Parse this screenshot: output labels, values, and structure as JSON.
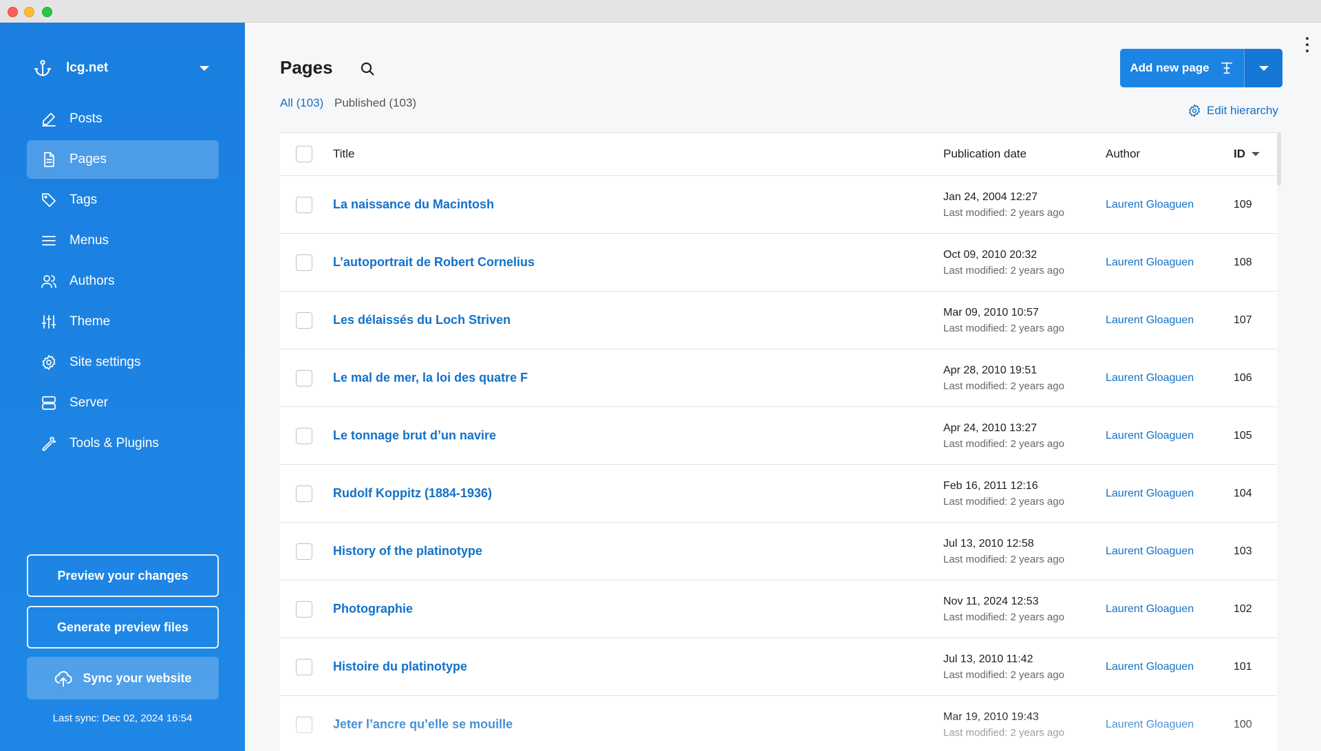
{
  "sidebar": {
    "site_name": "lcg.net",
    "items": [
      {
        "label": "Posts",
        "icon": "pencil-icon"
      },
      {
        "label": "Pages",
        "icon": "page-icon",
        "active": true
      },
      {
        "label": "Tags",
        "icon": "tag-icon"
      },
      {
        "label": "Menus",
        "icon": "menu-icon"
      },
      {
        "label": "Authors",
        "icon": "users-icon"
      },
      {
        "label": "Theme",
        "icon": "sliders-icon"
      },
      {
        "label": "Site settings",
        "icon": "gear-icon"
      },
      {
        "label": "Server",
        "icon": "server-icon"
      },
      {
        "label": "Tools & Plugins",
        "icon": "wrench-icon"
      }
    ],
    "preview_label": "Preview your changes",
    "generate_label": "Generate preview files",
    "sync_label": "Sync your website",
    "last_sync": "Last sync: Dec 02, 2024 16:54"
  },
  "main": {
    "title": "Pages",
    "filters": {
      "all": "All (103)",
      "published": "Published (103)"
    },
    "add_button": "Add new page",
    "edit_hierarchy": "Edit hierarchy",
    "columns": {
      "title": "Title",
      "date": "Publication date",
      "author": "Author",
      "id": "ID"
    },
    "rows": [
      {
        "title": "La naissance du Macintosh",
        "date": "Jan 24, 2004 12:27",
        "modified": "Last modified: 2 years ago",
        "author": "Laurent Gloaguen",
        "id": "109"
      },
      {
        "title": "L’autoportrait de Robert Cornelius",
        "date": "Oct 09, 2010 20:32",
        "modified": "Last modified: 2 years ago",
        "author": "Laurent Gloaguen",
        "id": "108"
      },
      {
        "title": "Les délaissés du Loch Striven",
        "date": "Mar 09, 2010 10:57",
        "modified": "Last modified: 2 years ago",
        "author": "Laurent Gloaguen",
        "id": "107"
      },
      {
        "title": "Le mal de mer, la loi des quatre F",
        "date": "Apr 28, 2010 19:51",
        "modified": "Last modified: 2 years ago",
        "author": "Laurent Gloaguen",
        "id": "106"
      },
      {
        "title": "Le tonnage brut d’un navire",
        "date": "Apr 24, 2010 13:27",
        "modified": "Last modified: 2 years ago",
        "author": "Laurent Gloaguen",
        "id": "105"
      },
      {
        "title": "Rudolf Koppitz (1884-1936)",
        "date": "Feb 16, 2011 12:16",
        "modified": "Last modified: 2 years ago",
        "author": "Laurent Gloaguen",
        "id": "104"
      },
      {
        "title": "History of the platinotype",
        "date": "Jul 13, 2010 12:58",
        "modified": "Last modified: 2 years ago",
        "author": "Laurent Gloaguen",
        "id": "103"
      },
      {
        "title": "Photographie",
        "date": "Nov 11, 2024 12:53",
        "modified": "Last modified: 2 years ago",
        "author": "Laurent Gloaguen",
        "id": "102"
      },
      {
        "title": "Histoire du platinotype",
        "date": "Jul 13, 2010 11:42",
        "modified": "Last modified: 2 years ago",
        "author": "Laurent Gloaguen",
        "id": "101"
      },
      {
        "title": "Jeter l’ancre qu’elle se mouille",
        "date": "Mar 19, 2010 19:43",
        "modified": "Last modified: 2 years ago",
        "author": "Laurent Gloaguen",
        "id": "100"
      }
    ]
  },
  "colors": {
    "sidebar": "#1a7fe0",
    "accent": "#1371c9",
    "button": "#1c84e3"
  }
}
